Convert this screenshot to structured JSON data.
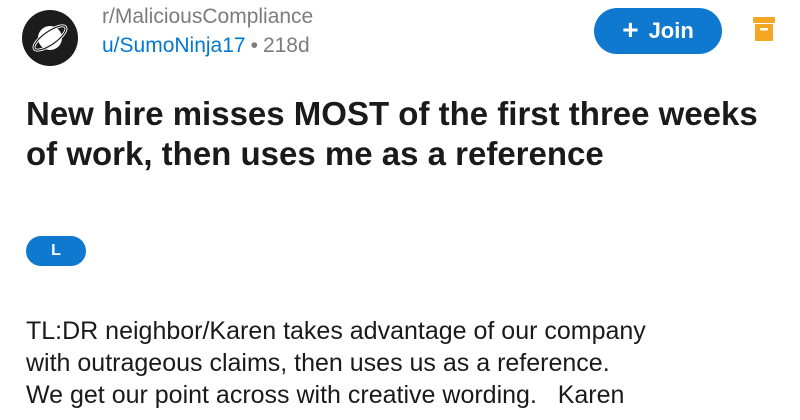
{
  "post": {
    "subreddit": "r/MaliciousCompliance",
    "author": "u/SumoNinja17",
    "separator": "•",
    "age": "218d",
    "join_label": "Join",
    "join_icon": "plus-icon",
    "title": "New hire misses MOST of the first three weeks of work, then uses me as a reference",
    "flair": "L",
    "body": "TL:DR neighbor/Karen takes advantage of our company\nwith outrageous claims, then uses us as a reference.\nWe get our point across with creative wording.   Karen"
  },
  "colors": {
    "accent": "#0f79d0",
    "username": "#0079d3",
    "archive_icon": "#f5a623",
    "muted_text": "#7c7c7c"
  }
}
